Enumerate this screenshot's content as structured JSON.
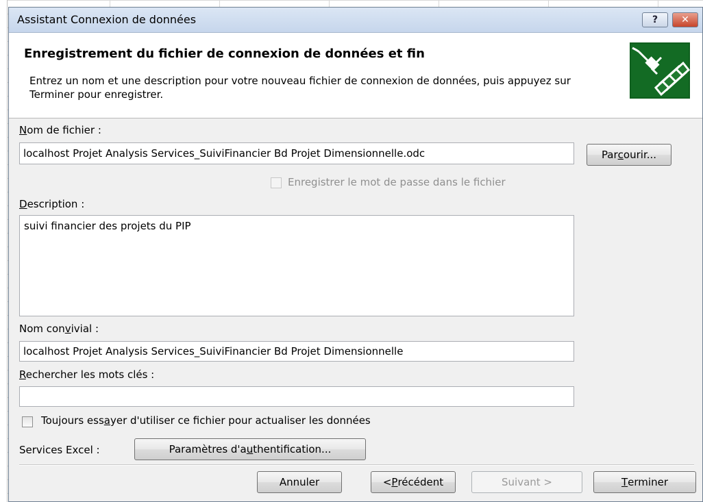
{
  "window": {
    "title": "Assistant Connexion de données",
    "help_label": "?",
    "close_label": "✕"
  },
  "header": {
    "title": "Enregistrement du fichier de connexion de données et fin",
    "description": "Entrez un nom et une description pour votre nouveau fichier de connexion de données, puis appuyez sur Terminer pour enregistrer.",
    "icon": "data-connection-plug-icon"
  },
  "filename": {
    "label_access": "N",
    "label_rest": "om de fichier :",
    "value": "localhost Projet Analysis Services_SuiviFinancier Bd Projet Dimensionnelle.odc",
    "browse_pre": "Par",
    "browse_access": "c",
    "browse_post": "ourir..."
  },
  "save_password": {
    "label": "Enregistrer le mot de passe dans le fichier",
    "checked": false,
    "enabled": false
  },
  "description": {
    "label_access": "D",
    "label_rest": "escription :",
    "value": "suivi financier des projets du PIP"
  },
  "friendly_name": {
    "label_pre": "Nom con",
    "label_access": "v",
    "label_post": "ivial :",
    "value": "localhost Projet Analysis Services_SuiviFinancier Bd Projet Dimensionnelle"
  },
  "keywords": {
    "label_access": "R",
    "label_rest": "echercher les mots clés :",
    "value": ""
  },
  "always_use": {
    "label_pre": "Toujours ess",
    "label_access": "a",
    "label_post": "yer d'utiliser ce fichier pour actualiser les données",
    "checked": false
  },
  "excel_services": {
    "label": "Services Excel :",
    "auth_pre": "Paramètres d'a",
    "auth_access": "u",
    "auth_post": "thentification..."
  },
  "footer": {
    "cancel": "Annuler",
    "back_pre": "< ",
    "back_access": "P",
    "back_post": "récédent",
    "next": "Suivant >",
    "finish_access": "T",
    "finish_post": "erminer"
  }
}
